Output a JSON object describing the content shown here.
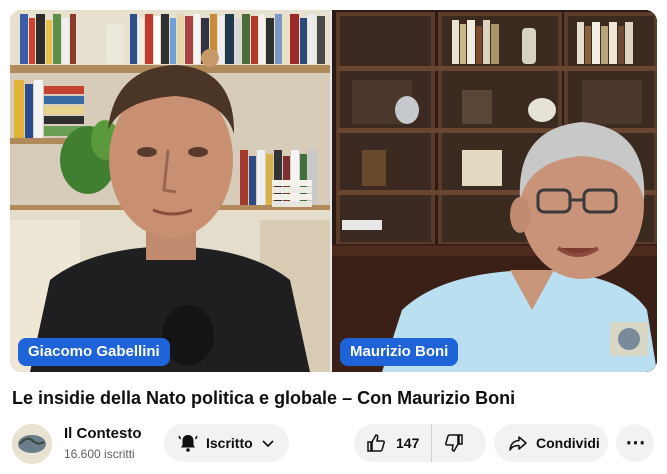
{
  "video": {
    "title": "Le insidie della Nato politica e globale – Con Maurizio Boni",
    "left_speaker": "Giacomo Gabellini",
    "right_speaker": "Maurizio Boni"
  },
  "channel": {
    "name": "Il Contesto",
    "subscribers": "16.600 iscritti",
    "logo_icon": "channel-logo-icon"
  },
  "actions": {
    "subscribe_label": "Iscritto",
    "like_count": "147",
    "share_label": "Condividi"
  },
  "colors": {
    "name_pill": "#1e63d8",
    "button_bg": "#f2f2f2"
  }
}
